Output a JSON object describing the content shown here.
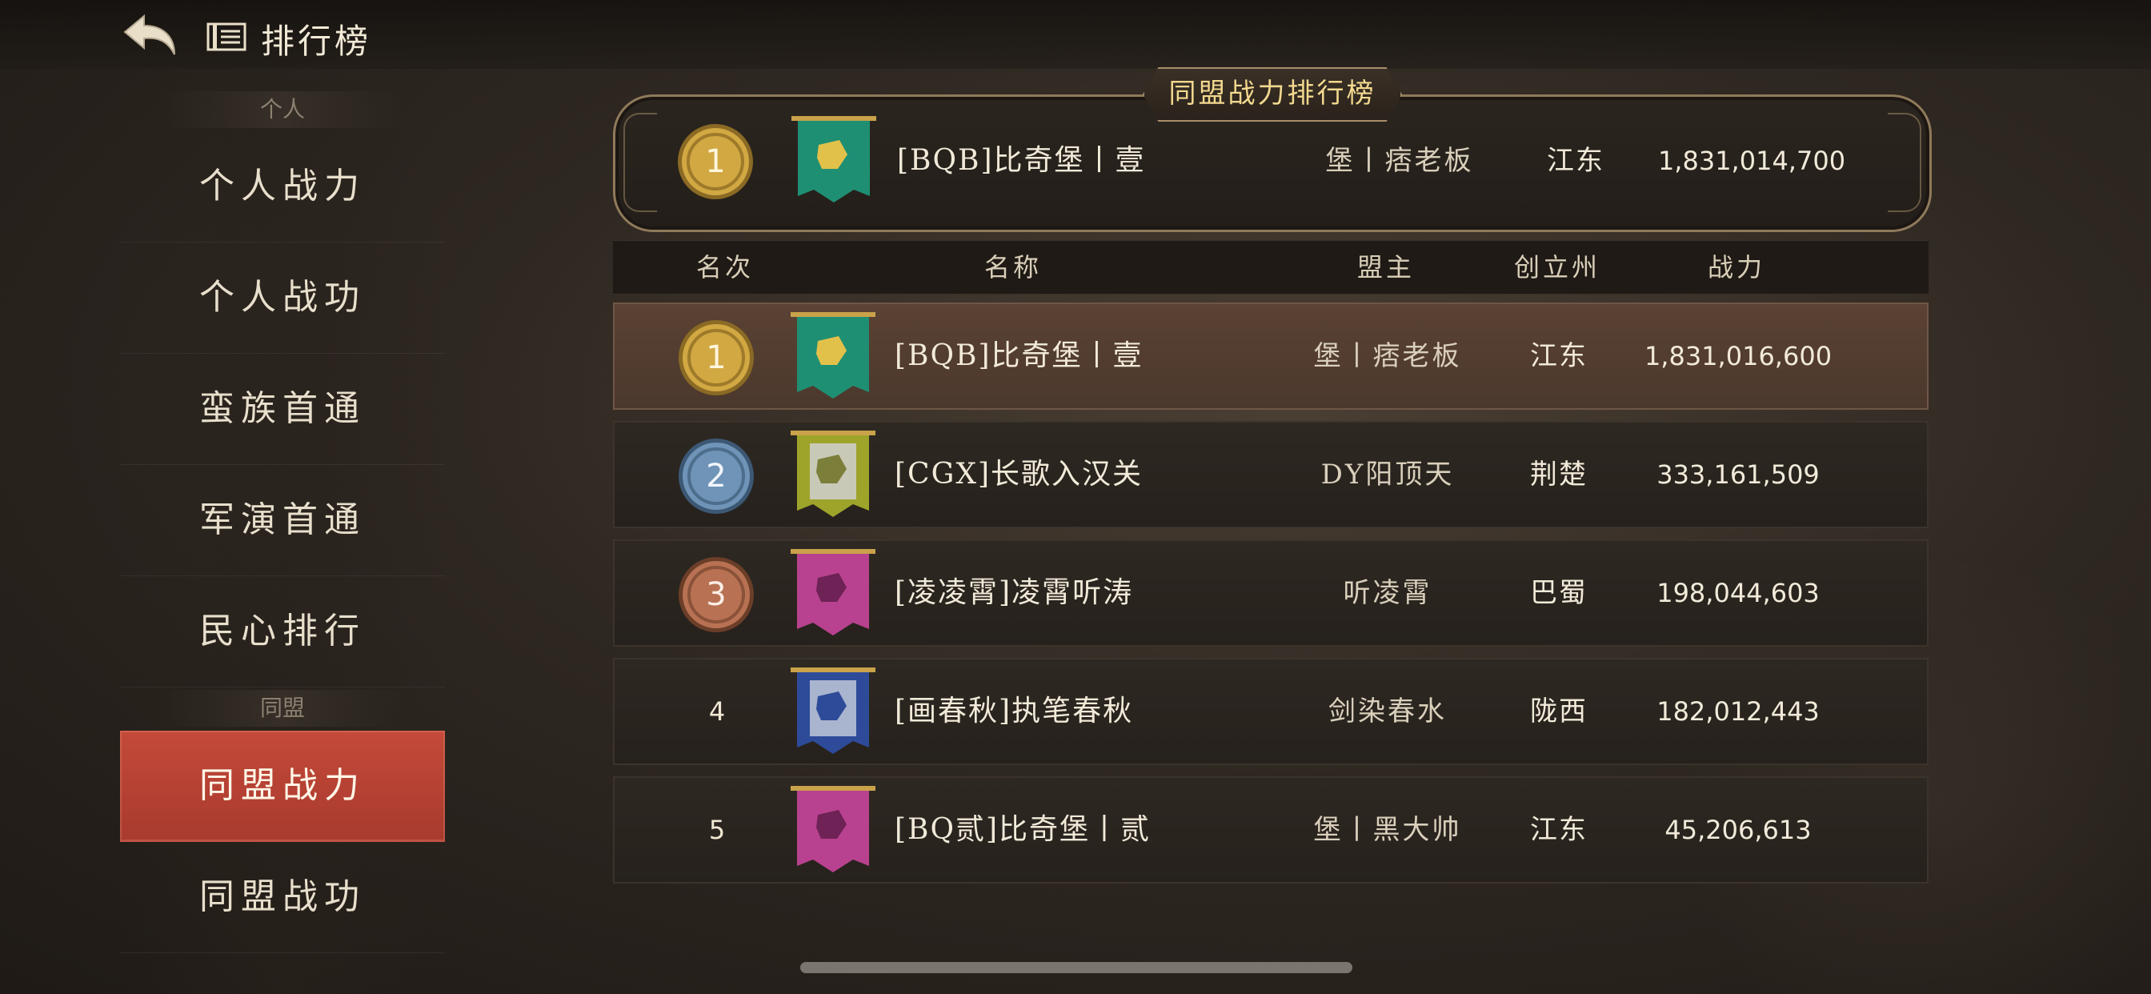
{
  "header": {
    "title": "排行榜"
  },
  "sidebar": {
    "section_personal": "个人",
    "section_alliance": "同盟",
    "items": [
      {
        "label": "个人战力"
      },
      {
        "label": "个人战功"
      },
      {
        "label": "蛮族首通"
      },
      {
        "label": "军演首通"
      },
      {
        "label": "民心排行"
      },
      {
        "label": "同盟战力",
        "active": true
      },
      {
        "label": "同盟战功"
      }
    ]
  },
  "panel": {
    "title": "同盟战力排行榜",
    "my_alliance": {
      "rank": "1",
      "name": "[BQB]比奇堡丨壹",
      "leader": "堡丨痞老板",
      "state": "江东",
      "power": "1,831,014,700",
      "flag_color": "#1f8f73"
    },
    "columns": {
      "rank": "名次",
      "name": "名称",
      "leader": "盟主",
      "state": "创立州",
      "power": "战力"
    },
    "rows": [
      {
        "rank": "1",
        "name": "[BQB]比奇堡丨壹",
        "leader": "堡丨痞老板",
        "state": "江东",
        "power": "1,831,016,600",
        "medal": "gold",
        "flag_color": "#1f8f73"
      },
      {
        "rank": "2",
        "name": "[CGX]长歌入汉关",
        "leader": "DY阳顶天",
        "state": "荆楚",
        "power": "333,161,509",
        "medal": "silver",
        "flag_color": "#9ea42a"
      },
      {
        "rank": "3",
        "name": "[凌凌霄]凌霄听涛",
        "leader": "听凌霄",
        "state": "巴蜀",
        "power": "198,044,603",
        "medal": "bronze",
        "flag_color": "#b8428f"
      },
      {
        "rank": "4",
        "name": "[画春秋]执笔春秋",
        "leader": "剑染春水",
        "state": "陇西",
        "power": "182,012,443",
        "medal": "none",
        "flag_color": "#2e4b9a"
      },
      {
        "rank": "5",
        "name": "[BQ贰]比奇堡丨贰",
        "leader": "堡丨黑大帅",
        "state": "江东",
        "power": "45,206,613",
        "medal": "none",
        "flag_color": "#b8428f"
      }
    ]
  },
  "icons": {
    "back": "back-arrow-icon",
    "doc": "list-doc-icon",
    "medal": "medal-icon",
    "flag": "alliance-banner-icon"
  }
}
